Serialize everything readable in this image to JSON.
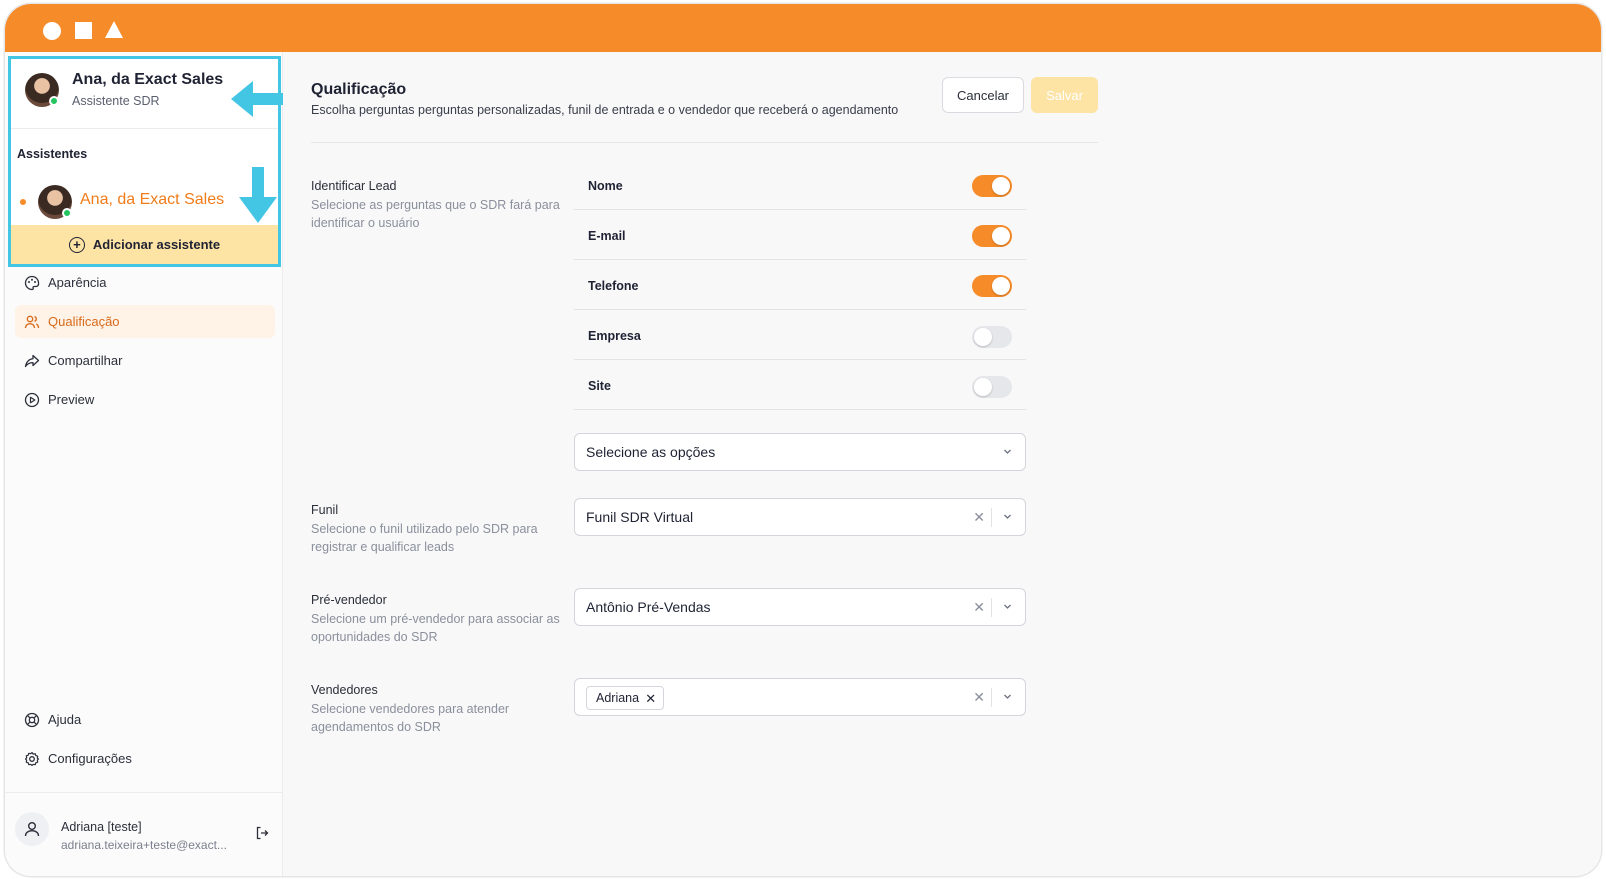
{
  "sidebar": {
    "current": {
      "name": "Ana, da Exact Sales",
      "role": "Assistente SDR"
    },
    "assistants_heading": "Assistentes",
    "assistants": [
      {
        "name": "Ana, da Exact Sales"
      }
    ],
    "add_assistant_label": "Adicionar assistente",
    "nav": [
      {
        "label": "Aparência",
        "icon": "palette-icon"
      },
      {
        "label": "Qualificação",
        "icon": "users-icon",
        "active": true
      },
      {
        "label": "Compartilhar",
        "icon": "share-icon"
      },
      {
        "label": "Preview",
        "icon": "play-icon"
      }
    ],
    "bottom_nav": [
      {
        "label": "Ajuda",
        "icon": "lifebuoy-icon"
      },
      {
        "label": "Configurações",
        "icon": "gear-icon"
      }
    ],
    "user": {
      "name": "Adriana [teste]",
      "email": "adriana.teixeira+teste@exact..."
    }
  },
  "header": {
    "title": "Qualificação",
    "subtitle": "Escolha perguntas perguntas personalizadas, funil de entrada e o vendedor que receberá o agendamento",
    "cancel_label": "Cancelar",
    "save_label": "Salvar"
  },
  "identify": {
    "title": "Identificar Lead",
    "description": "Selecione as perguntas que o SDR fará para identificar o usuário",
    "fields": [
      {
        "label": "Nome",
        "enabled": true
      },
      {
        "label": "E-mail",
        "enabled": true
      },
      {
        "label": "Telefone",
        "enabled": true
      },
      {
        "label": "Empresa",
        "enabled": false
      },
      {
        "label": "Site",
        "enabled": false
      }
    ],
    "options_placeholder": "Selecione as opções"
  },
  "funil": {
    "title": "Funil",
    "description": "Selecione o funil utilizado pelo SDR para registrar e qualificar leads",
    "value": "Funil SDR Virtual"
  },
  "prevendedor": {
    "title": "Pré-vendedor",
    "description": "Selecione um pré-vendedor para associar as oportunidades do SDR",
    "value": "Antônio Pré-Vendas"
  },
  "vendedores": {
    "title": "Vendedores",
    "description": "Selecione vendedores para atender agendamentos do SDR",
    "chips": [
      "Adriana"
    ]
  },
  "colors": {
    "accent": "#f68b29",
    "highlight": "#43c5e4",
    "add_button": "#fde3a4"
  }
}
